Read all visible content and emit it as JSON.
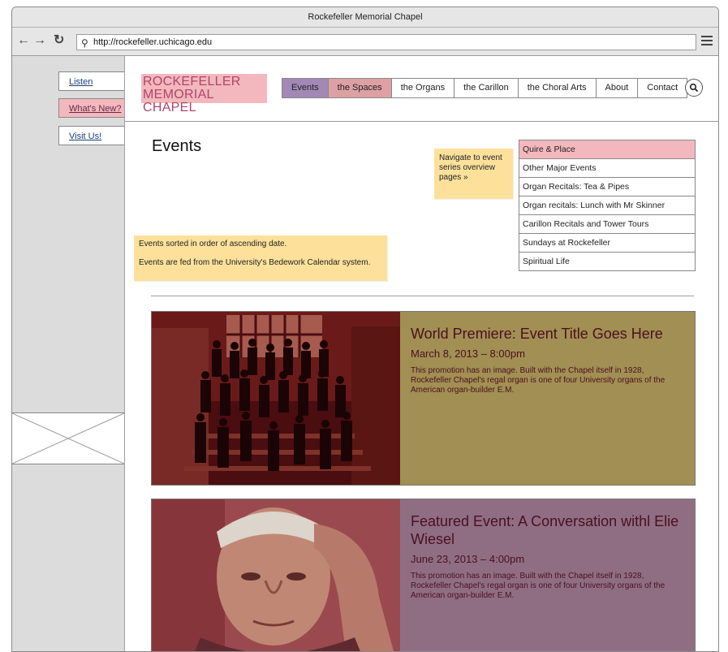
{
  "browser": {
    "window_title": "Rockefeller Memorial Chapel",
    "url": "http://rockefeller.uchicago.edu",
    "back_glyph": "←",
    "forward_glyph": "→",
    "reload_glyph": "↻",
    "search_glyph": "⚲"
  },
  "sidebar": {
    "links": [
      {
        "label": "Listen"
      },
      {
        "label": "What's New?"
      },
      {
        "label": "Visit Us!"
      }
    ]
  },
  "header": {
    "logo_line1": "ROCKEFELLER",
    "logo_line2": "MEMORIAL CHAPEL",
    "nav": [
      {
        "label": "Events"
      },
      {
        "label": "the Spaces"
      },
      {
        "label": "the Organs"
      },
      {
        "label": "the Carillon"
      },
      {
        "label": "the Choral Arts"
      },
      {
        "label": "About"
      },
      {
        "label": "Contact"
      }
    ],
    "search_glyph": "🔍"
  },
  "main": {
    "title": "Events",
    "note_nav": "Navigate to event series overview pages »",
    "note_sort_line1": "Events sorted in order of ascending date.",
    "note_sort_line2": "Events are fed from the University's Bedework Calendar system.",
    "series": [
      {
        "label": "Quire & Place"
      },
      {
        "label": "Other Major Events"
      },
      {
        "label": "Organ Recitals: Tea & Pipes"
      },
      {
        "label": "Organ recitals: Lunch with Mr Skinner"
      },
      {
        "label": "Carillon Recitals and Tower Tours"
      },
      {
        "label": "Sundays at Rockefeller"
      },
      {
        "label": "Spiritual Life"
      }
    ],
    "promos": [
      {
        "title": "World Premiere: Event Title Goes Here",
        "date": "March 8, 2013 – 8:00pm",
        "body": "This promotion has an image. Built with the Chapel itself in 1928, Rockefeller Chapel's regal organ is one of four University organs of the American organ-builder E.M."
      },
      {
        "title": "Featured Event: A Conversation withl Elie Wiesel",
        "date": "June 23, 2013 – 4:00pm",
        "body": "This promotion has an image. Built with the Chapel itself in 1928, Rockefeller Chapel's regal organ is one of four University organs of the American organ-builder E.M."
      }
    ]
  },
  "colors": {
    "accent_pink": "#f3b8bd",
    "events_purple": "#a288b5",
    "promo1_bg": "#a28f53",
    "promo2_bg": "#8f6e84",
    "sticky": "#fde19b"
  }
}
